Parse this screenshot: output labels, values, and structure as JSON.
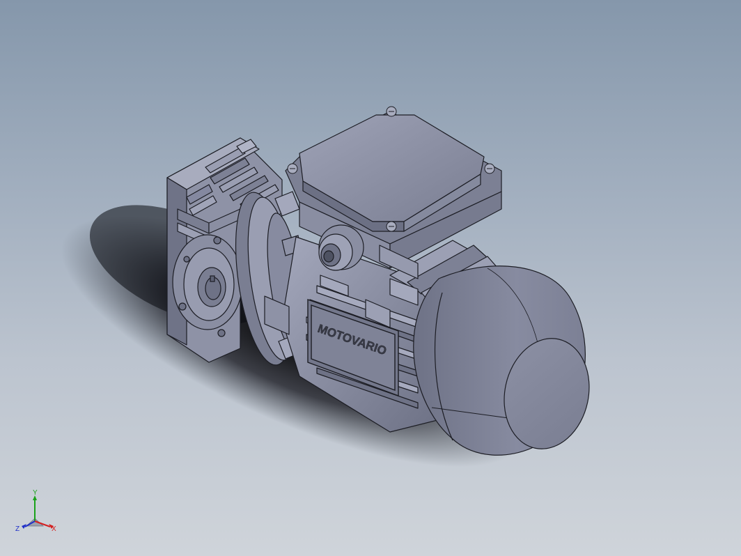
{
  "viewport": {
    "background_top": "#8597ab",
    "background_bottom": "#cfd4da",
    "model_color": "#8a8ea2",
    "edge_color": "#1c1d24"
  },
  "model": {
    "nameplate_text": "MOTOVARIO"
  },
  "triad": {
    "x_label": "X",
    "y_label": "Y",
    "z_label": "Z",
    "x_color": "#d42020",
    "y_color": "#1aa21a",
    "z_color": "#2030c8"
  }
}
